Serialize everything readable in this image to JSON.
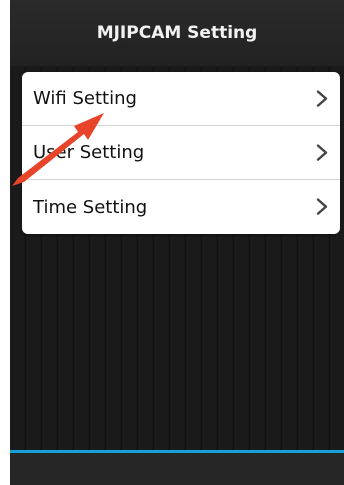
{
  "header": {
    "title": "MJIPCAM  Setting"
  },
  "menu": {
    "items": [
      {
        "label": "Wifi Setting"
      },
      {
        "label": "User Setting"
      },
      {
        "label": "Time Setting"
      }
    ]
  },
  "colors": {
    "accent": "#1aa0d8",
    "annotation_arrow": "#e8442a"
  },
  "icons": {
    "row_icon": "chevron-right-icon",
    "overlay": "red-annotation-arrow"
  }
}
